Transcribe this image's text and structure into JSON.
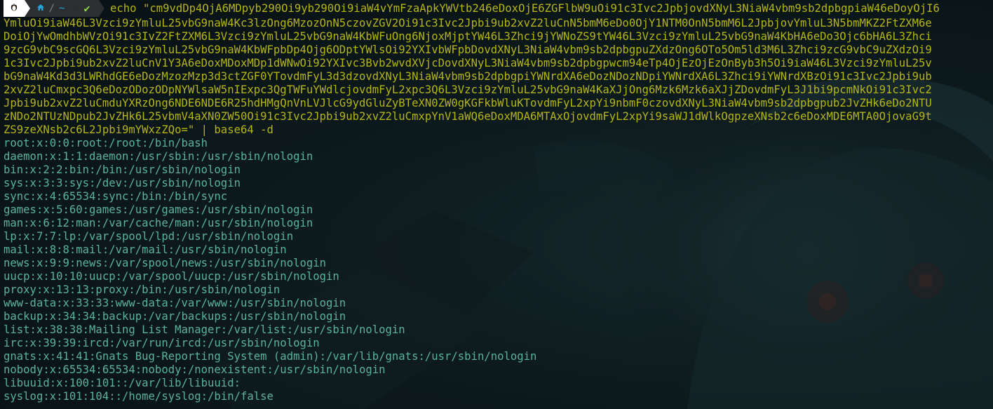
{
  "prompt": {
    "os_icon": "linux-tux-icon",
    "home_icon": "home-icon",
    "directory": "~",
    "separator": "/",
    "status_icon": "checkmark-icon",
    "status_glyph": "✔"
  },
  "command_lines": [
    "echo \"cm9vdDp4OjA6MDpyb290Oi9yb290Oi9iaW4vYmFzaApkYWVtb246eDoxOjE6ZGFlbW9uOi91c3Ivc2JpbjovdXNyL3NiaW4vbm9sb2dpbgpiaW46eDoyOjI6",
    "YmluOi9iaW46L3Vzci9zYmluL25vbG9naW4Kc3lzOng6MzozOnN5czovZGV2Oi91c3Ivc2Jpbi9ub2xvZ2luCnN5bmM6eDo0OjY1NTM0OnN5bmM6L2JpbjovYmluL3N5bmMKZ2FtZXM6e",
    "DoiOjYwOmdhbWVzOi91c3IvZ2FtZXM6L3Vzci9zYmluL25vbG9naW4KbWFuOng6NjoxMjptYW46L3Zhci9jYWNoZS9tYW46L3Vzci9zYmluL25vbG9naW4KbHA6eDo3Ojc6bHA6L3Zhci",
    "9zcG9vbC9scGQ6L3Vzci9zYmluL25vbG9naW4KbWFpbDp4Ojg6ODptYWlsOi92YXIvbWFpbDovdXNyL3NiaW4vbm9sb2dpbgpuZXdzOng6OTo5Om5ld3M6L3Zhci9zcG9vbC9uZXdzOi9",
    "1c3Ivc2Jpbi9ub2xvZ2luCnV1Y3A6eDoxMDoxMDp1dWNwOi92YXIvc3Bvb2wvdXVjcDovdXNyL3NiaW4vbm9sb2dpbgpwcm94eTp4OjEzOjEzOnByb3h5Oi9iaW46L3Vzci9zYmluL25v",
    "bG9naW4Kd3d3LWRhdGE6eDozMzozMzp3d3ctZGF0YTovdmFyL3d3dzovdXNyL3NiaW4vbm9sb2dpbgpiYWNrdXA6eDozNDozNDpiYWNrdXA6L3Zhci9iYWNrdXBzOi91c3Ivc2Jpbi9ub",
    "2xvZ2luCmxpc3Q6eDozODozODpNYWlsaW5nIExpc3QgTWFuYWdlcjovdmFyL2xpc3Q6L3Vzci9zYmluL25vbG9naW4KaXJjOng6Mzk6Mzk6aXJjZDovdmFyL3J1bi9pcmNkOi91c3Ivc2",
    "Jpbi9ub2xvZ2luCmduYXRzOng6NDE6NDE6R25hdHMgQnVnLVJlcG9ydGluZyBTeXN0ZW0gKGFkbWluKTovdmFyL2xpYi9nbmF0czovdXNyL3NiaW4vbm9sb2dpbgpub2JvZHk6eDo2NTU",
    "zNDo2NTUzNDpub2JvZHk6L25vbmV4aXN0ZW50Oi91c3Ivc2Jpbi9ub2xvZ2luCmxpYnV1aWQ6eDoxMDA6MTAxOjovdmFyL2xpYi9saWJ1dWlkOgpzeXNsb2c6eDoxMDE6MTA0OjovaG9t",
    "ZS9zeXNsb2c6L2Jpbi9mYWxzZQo=\" | base64 -d"
  ],
  "output_lines": [
    "root:x:0:0:root:/root:/bin/bash",
    "daemon:x:1:1:daemon:/usr/sbin:/usr/sbin/nologin",
    "bin:x:2:2:bin:/bin:/usr/sbin/nologin",
    "sys:x:3:3:sys:/dev:/usr/sbin/nologin",
    "sync:x:4:65534:sync:/bin:/bin/sync",
    "games:x:5:60:games:/usr/games:/usr/sbin/nologin",
    "man:x:6:12:man:/var/cache/man:/usr/sbin/nologin",
    "lp:x:7:7:lp:/var/spool/lpd:/usr/sbin/nologin",
    "mail:x:8:8:mail:/var/mail:/usr/sbin/nologin",
    "news:x:9:9:news:/var/spool/news:/usr/sbin/nologin",
    "uucp:x:10:10:uucp:/var/spool/uucp:/usr/sbin/nologin",
    "proxy:x:13:13:proxy:/bin:/usr/sbin/nologin",
    "www-data:x:33:33:www-data:/var/www:/usr/sbin/nologin",
    "backup:x:34:34:backup:/var/backups:/usr/sbin/nologin",
    "list:x:38:38:Mailing List Manager:/var/list:/usr/sbin/nologin",
    "irc:x:39:39:ircd:/var/run/ircd:/usr/sbin/nologin",
    "gnats:x:41:41:Gnats Bug-Reporting System (admin):/var/lib/gnats:/usr/sbin/nologin",
    "nobody:x:65534:65534:nobody:/nonexistent:/usr/sbin/nologin",
    "libuuid:x:100:101::/var/lib/libuuid:",
    "syslog:x:101:104::/home/syslog:/bin/false"
  ],
  "colors": {
    "command": "#b5b516",
    "output": "#5ab39c",
    "dir": "#26a6d4",
    "status": "#8fd44a"
  }
}
